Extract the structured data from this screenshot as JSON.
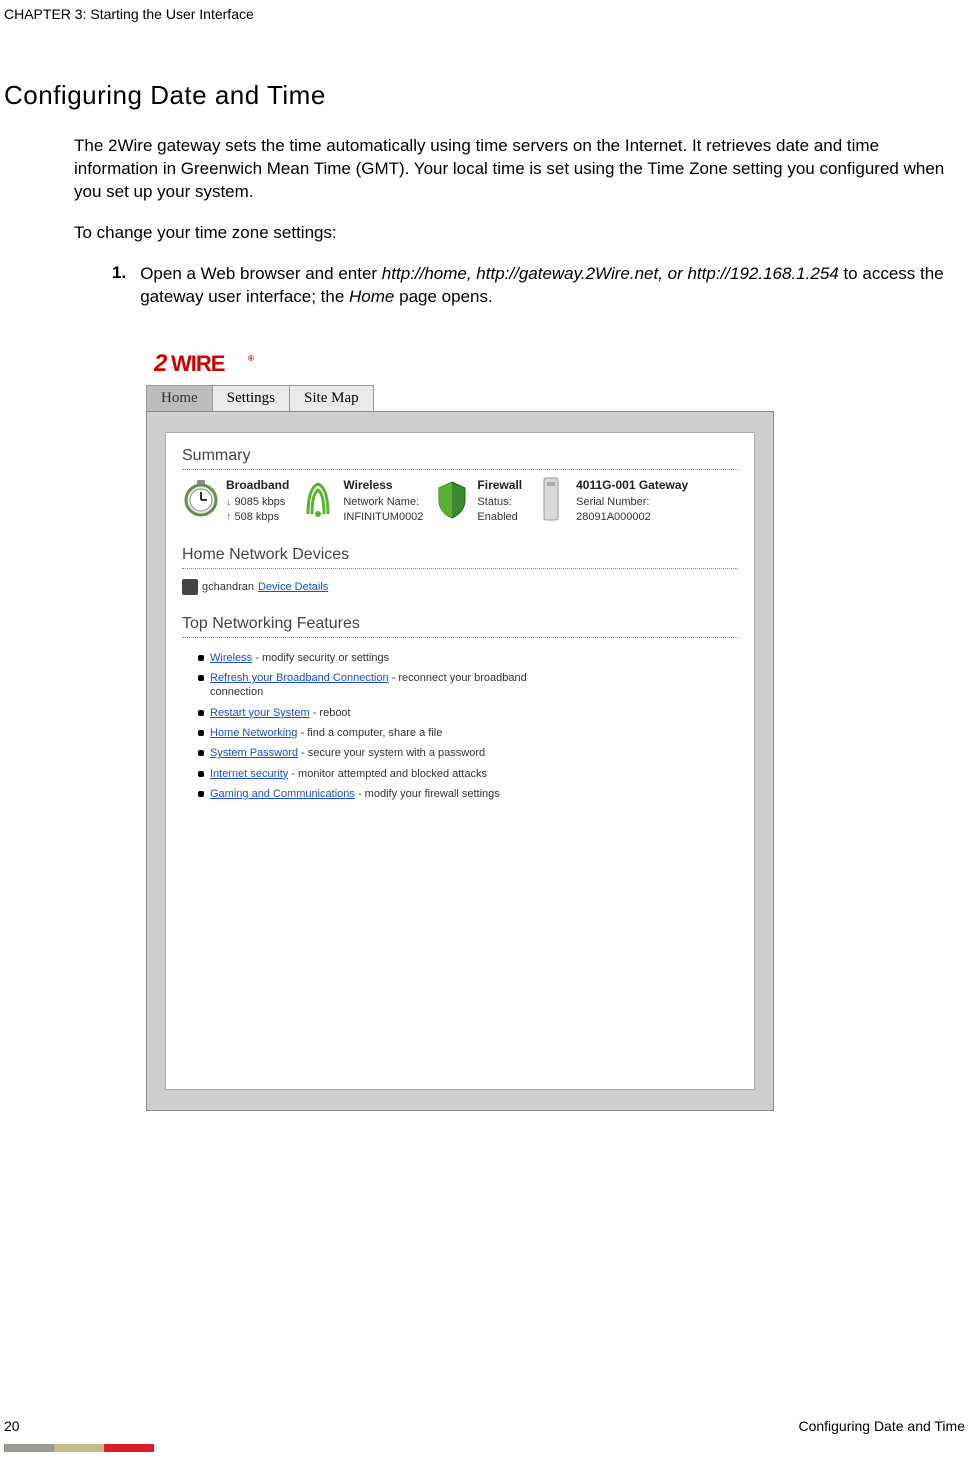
{
  "chapter": "CHAPTER 3: Starting the User Interface",
  "section_title": "Configuring Date and Time",
  "para1": "The 2Wire gateway sets the time automatically using time servers on the Internet. It retrieves date and time information in Greenwich Mean Time (GMT). Your local time is set using the Time Zone setting you configured when you set up your system.",
  "para2": "To change your time zone settings:",
  "step1_num": "1.",
  "step1_prefix": "Open a Web browser and enter ",
  "step1_italic": "http://home, http://gateway.2Wire.net, or http://192.168.1.254",
  "step1_mid": " to access the gateway user interface; the ",
  "step1_italic2": "Home",
  "step1_suffix": " page opens.",
  "logo": "2WIRE",
  "tabs": {
    "home": "Home",
    "settings": "Settings",
    "sitemap": "Site Map"
  },
  "summary": {
    "heading": "Summary",
    "broadband": {
      "title": "Broadband",
      "down": "9085 kbps",
      "up": "508 kbps"
    },
    "wireless": {
      "title": "Wireless",
      "label": "Network Name:",
      "value": "INFINITUM0002"
    },
    "firewall": {
      "title": "Firewall",
      "label": "Status:",
      "value": "Enabled"
    },
    "gateway": {
      "title": "4011G-001 Gateway",
      "label": "Serial Number:",
      "value": "28091A000002"
    }
  },
  "devices": {
    "heading": "Home Network Devices",
    "name": "gchandran",
    "link": "Device Details"
  },
  "features": {
    "heading": "Top Networking Features",
    "items": [
      {
        "link": "Wireless",
        "text": " - modify security or settings"
      },
      {
        "link": "Refresh your Broadband Connection",
        "text": " - reconnect your broadband connection"
      },
      {
        "link": "Restart your System",
        "text": " - reboot"
      },
      {
        "link": "Home Networking",
        "text": " - find a computer, share a file"
      },
      {
        "link": "System Password",
        "text": " - secure your system with a password"
      },
      {
        "link": "Internet security",
        "text": " - monitor attempted and blocked attacks"
      },
      {
        "link": "Gaming and Communications",
        "text": " - modify your firewall settings"
      }
    ]
  },
  "footer": {
    "page": "20",
    "title": "Configuring Date and Time"
  }
}
